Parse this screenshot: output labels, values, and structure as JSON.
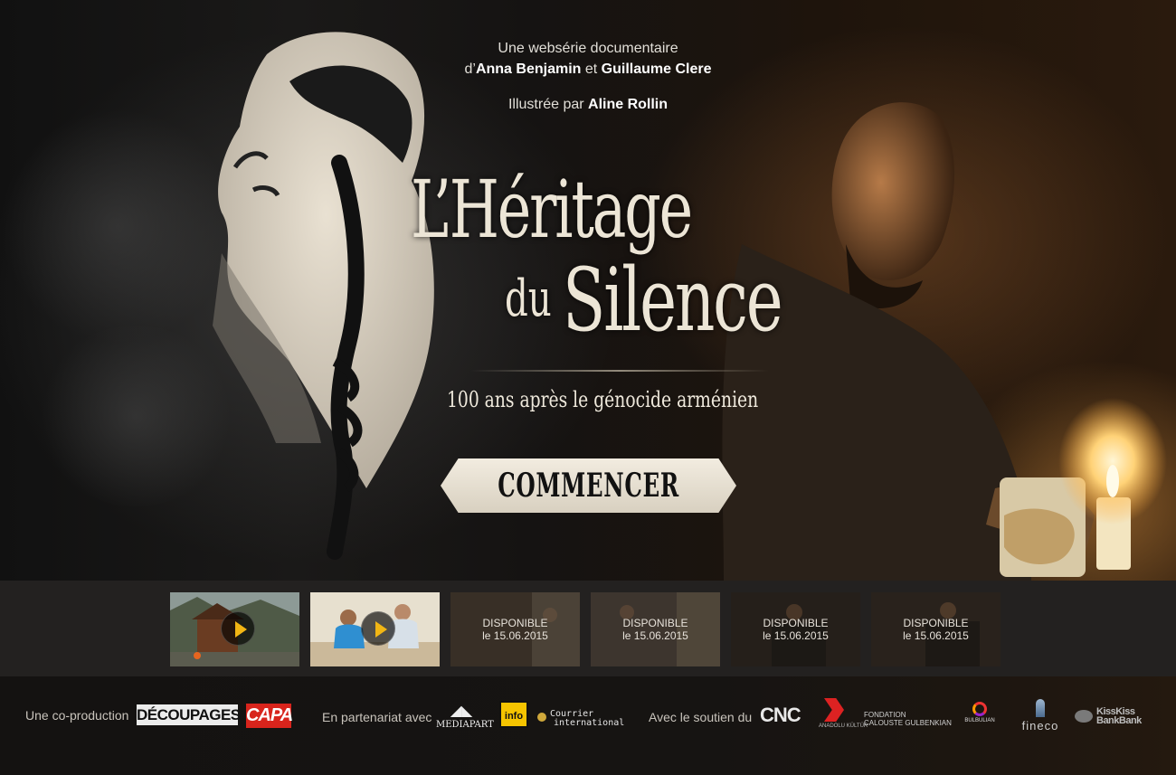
{
  "hero": {
    "credits_line1": "Une websérie documentaire",
    "credits_prefix": "d’",
    "author1": "Anna Benjamin",
    "credits_and": "et",
    "author2": "Guillaume Clere",
    "illustrated_by": "Illustrée par",
    "illustrator": "Aline Rollin",
    "title_line1": "L’Héritage",
    "title_du": "du",
    "title_line2": "Silence",
    "subtitle": "100 ans après le génocide arménien",
    "start_button": "COMMENCER"
  },
  "episodes": [
    {
      "state": "playable",
      "thumb": "wooden-house-in-forest",
      "icon": "play-icon"
    },
    {
      "state": "playable",
      "thumb": "two-men-at-table",
      "icon": "play-icon"
    },
    {
      "state": "upcoming",
      "line1": "DISPONIBLE",
      "line2": "le 15.06.2015"
    },
    {
      "state": "upcoming",
      "line1": "DISPONIBLE",
      "line2": "le 15.06.2015"
    },
    {
      "state": "upcoming",
      "line1": "DISPONIBLE",
      "line2": "le 15.06.2015"
    },
    {
      "state": "upcoming",
      "line1": "DISPONIBLE",
      "line2": "le 15.06.2015"
    }
  ],
  "footer": {
    "coproduction_label": "Une co-production",
    "partners_label": "En partenariat avec",
    "support_label": "Avec le soutien du",
    "logos": {
      "decoupages": "DÉCOUPAGES",
      "capa": "CAPA",
      "mediapart": "MEDIAPART",
      "franceinfo": "info",
      "courrier_1": "Courrier",
      "courrier_2": "international",
      "cnc": "CNC",
      "anadolu": "ANADOLU KÜLTÜR",
      "gulbenkian_1": "FONDATION",
      "gulbenkian_2": "CALOUSTE GULBENKIAN",
      "bulbulian": "BULBULIAN",
      "fineco": "fineco",
      "kisskiss_1": "KissKiss",
      "kisskiss_2": "BankBank"
    }
  },
  "colors": {
    "play_accent": "#f2b614",
    "button_bg": "#ece5d6",
    "capa_red": "#d8241c"
  }
}
